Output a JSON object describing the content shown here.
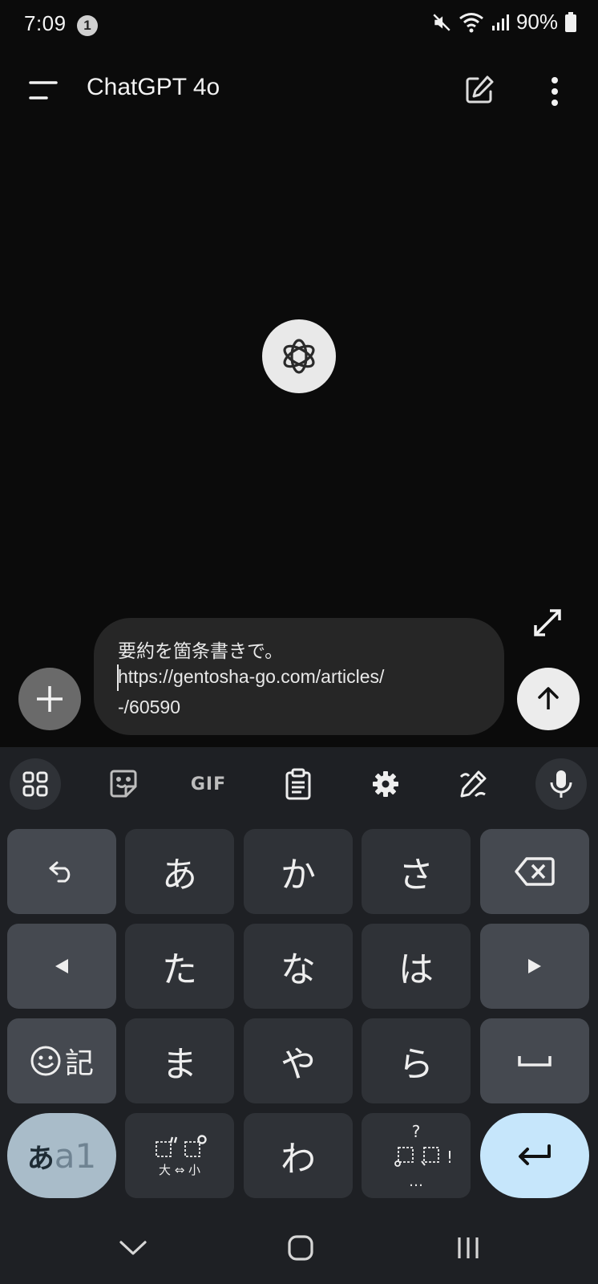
{
  "status_bar": {
    "time": "7:09",
    "notification_count": "1",
    "battery": "90%"
  },
  "app_bar": {
    "title": "ChatGPT 4o"
  },
  "composer": {
    "line1": "要約を箇条書きで。",
    "line2": "https://gentosha-go.com/articles/",
    "line3": "-/60590"
  },
  "keyboard": {
    "toolbar_gif": "GIF",
    "row1": [
      "あ",
      "か",
      "さ"
    ],
    "row2": [
      "た",
      "な",
      "は"
    ],
    "row3": [
      "ま",
      "や",
      "ら"
    ],
    "row4_center": "わ",
    "kigou_label": "記",
    "mode_label_kana": "あ",
    "mode_label_alnum": "a1",
    "dakuten_bottom": "大 ⇔ 小"
  },
  "colors": {
    "background": "#0b0b0b",
    "keyboard_bg": "#1e2024",
    "key_bg": "#2f3237",
    "enter_key": "#c6e6fb"
  }
}
